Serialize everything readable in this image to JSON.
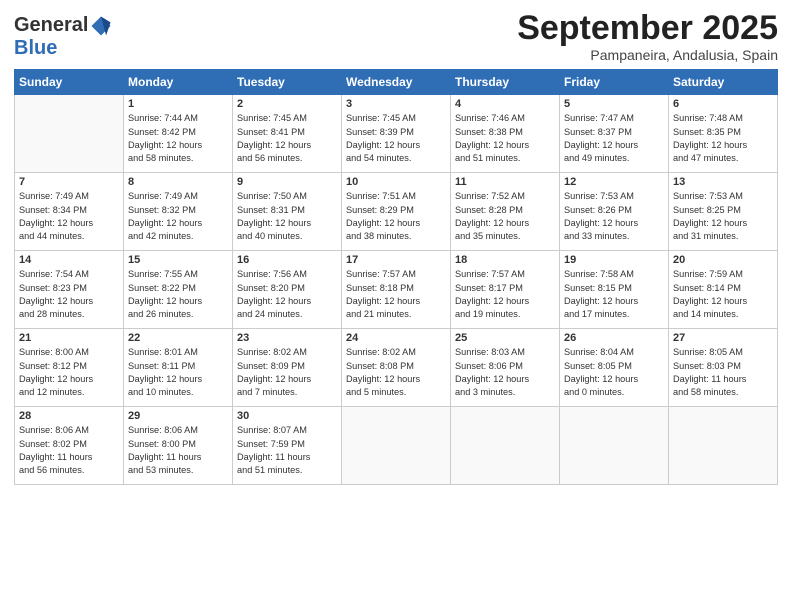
{
  "header": {
    "logo_line1": "General",
    "logo_line2": "Blue",
    "month": "September 2025",
    "location": "Pampaneira, Andalusia, Spain"
  },
  "weekdays": [
    "Sunday",
    "Monday",
    "Tuesday",
    "Wednesday",
    "Thursday",
    "Friday",
    "Saturday"
  ],
  "weeks": [
    [
      {
        "day": "",
        "info": ""
      },
      {
        "day": "1",
        "info": "Sunrise: 7:44 AM\nSunset: 8:42 PM\nDaylight: 12 hours\nand 58 minutes."
      },
      {
        "day": "2",
        "info": "Sunrise: 7:45 AM\nSunset: 8:41 PM\nDaylight: 12 hours\nand 56 minutes."
      },
      {
        "day": "3",
        "info": "Sunrise: 7:45 AM\nSunset: 8:39 PM\nDaylight: 12 hours\nand 54 minutes."
      },
      {
        "day": "4",
        "info": "Sunrise: 7:46 AM\nSunset: 8:38 PM\nDaylight: 12 hours\nand 51 minutes."
      },
      {
        "day": "5",
        "info": "Sunrise: 7:47 AM\nSunset: 8:37 PM\nDaylight: 12 hours\nand 49 minutes."
      },
      {
        "day": "6",
        "info": "Sunrise: 7:48 AM\nSunset: 8:35 PM\nDaylight: 12 hours\nand 47 minutes."
      }
    ],
    [
      {
        "day": "7",
        "info": "Sunrise: 7:49 AM\nSunset: 8:34 PM\nDaylight: 12 hours\nand 44 minutes."
      },
      {
        "day": "8",
        "info": "Sunrise: 7:49 AM\nSunset: 8:32 PM\nDaylight: 12 hours\nand 42 minutes."
      },
      {
        "day": "9",
        "info": "Sunrise: 7:50 AM\nSunset: 8:31 PM\nDaylight: 12 hours\nand 40 minutes."
      },
      {
        "day": "10",
        "info": "Sunrise: 7:51 AM\nSunset: 8:29 PM\nDaylight: 12 hours\nand 38 minutes."
      },
      {
        "day": "11",
        "info": "Sunrise: 7:52 AM\nSunset: 8:28 PM\nDaylight: 12 hours\nand 35 minutes."
      },
      {
        "day": "12",
        "info": "Sunrise: 7:53 AM\nSunset: 8:26 PM\nDaylight: 12 hours\nand 33 minutes."
      },
      {
        "day": "13",
        "info": "Sunrise: 7:53 AM\nSunset: 8:25 PM\nDaylight: 12 hours\nand 31 minutes."
      }
    ],
    [
      {
        "day": "14",
        "info": "Sunrise: 7:54 AM\nSunset: 8:23 PM\nDaylight: 12 hours\nand 28 minutes."
      },
      {
        "day": "15",
        "info": "Sunrise: 7:55 AM\nSunset: 8:22 PM\nDaylight: 12 hours\nand 26 minutes."
      },
      {
        "day": "16",
        "info": "Sunrise: 7:56 AM\nSunset: 8:20 PM\nDaylight: 12 hours\nand 24 minutes."
      },
      {
        "day": "17",
        "info": "Sunrise: 7:57 AM\nSunset: 8:18 PM\nDaylight: 12 hours\nand 21 minutes."
      },
      {
        "day": "18",
        "info": "Sunrise: 7:57 AM\nSunset: 8:17 PM\nDaylight: 12 hours\nand 19 minutes."
      },
      {
        "day": "19",
        "info": "Sunrise: 7:58 AM\nSunset: 8:15 PM\nDaylight: 12 hours\nand 17 minutes."
      },
      {
        "day": "20",
        "info": "Sunrise: 7:59 AM\nSunset: 8:14 PM\nDaylight: 12 hours\nand 14 minutes."
      }
    ],
    [
      {
        "day": "21",
        "info": "Sunrise: 8:00 AM\nSunset: 8:12 PM\nDaylight: 12 hours\nand 12 minutes."
      },
      {
        "day": "22",
        "info": "Sunrise: 8:01 AM\nSunset: 8:11 PM\nDaylight: 12 hours\nand 10 minutes."
      },
      {
        "day": "23",
        "info": "Sunrise: 8:02 AM\nSunset: 8:09 PM\nDaylight: 12 hours\nand 7 minutes."
      },
      {
        "day": "24",
        "info": "Sunrise: 8:02 AM\nSunset: 8:08 PM\nDaylight: 12 hours\nand 5 minutes."
      },
      {
        "day": "25",
        "info": "Sunrise: 8:03 AM\nSunset: 8:06 PM\nDaylight: 12 hours\nand 3 minutes."
      },
      {
        "day": "26",
        "info": "Sunrise: 8:04 AM\nSunset: 8:05 PM\nDaylight: 12 hours\nand 0 minutes."
      },
      {
        "day": "27",
        "info": "Sunrise: 8:05 AM\nSunset: 8:03 PM\nDaylight: 11 hours\nand 58 minutes."
      }
    ],
    [
      {
        "day": "28",
        "info": "Sunrise: 8:06 AM\nSunset: 8:02 PM\nDaylight: 11 hours\nand 56 minutes."
      },
      {
        "day": "29",
        "info": "Sunrise: 8:06 AM\nSunset: 8:00 PM\nDaylight: 11 hours\nand 53 minutes."
      },
      {
        "day": "30",
        "info": "Sunrise: 8:07 AM\nSunset: 7:59 PM\nDaylight: 11 hours\nand 51 minutes."
      },
      {
        "day": "",
        "info": ""
      },
      {
        "day": "",
        "info": ""
      },
      {
        "day": "",
        "info": ""
      },
      {
        "day": "",
        "info": ""
      }
    ]
  ]
}
